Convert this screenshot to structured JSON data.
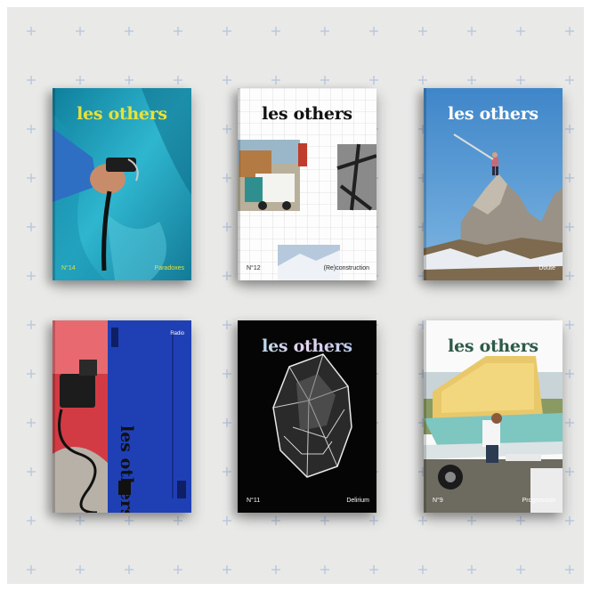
{
  "colors": {
    "backdrop": "#e9e9e8",
    "cross_marks": "#b8c7dd",
    "title_yellow": "#e7e13a",
    "deep_blue": "#1f40b5",
    "sky_blue": "#4b8ccd",
    "dark_green": "#2e5a47"
  },
  "covers": [
    {
      "title": "les others",
      "issue": "N°14",
      "theme": "Paradoxes",
      "icon": "ice-cave-hand-photo"
    },
    {
      "title": "les others",
      "issue": "N°12",
      "theme": "(Re)construction",
      "icon": "collage-grid-photo"
    },
    {
      "title": "les others",
      "issue": "",
      "theme": "Doute",
      "icon": "rock-summit-photo"
    },
    {
      "title": "les others",
      "spine_small": "Radio",
      "icon": "walkie-talkie-photo"
    },
    {
      "title": "les others",
      "issue": "N°11",
      "theme": "Delirium",
      "icon": "crystal-photo"
    },
    {
      "title": "les others",
      "issue": "N°9",
      "theme": "Progression",
      "icon": "boat-trailer-photo"
    }
  ]
}
